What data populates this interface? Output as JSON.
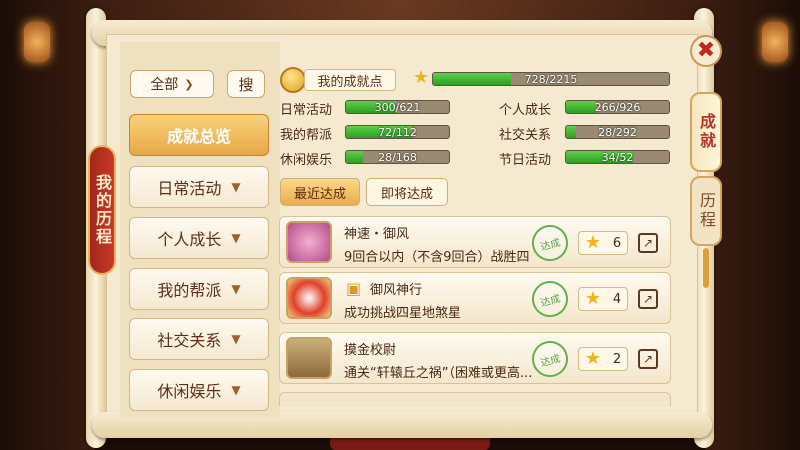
{
  "header": {
    "close_label": "✖"
  },
  "left_banner": "我的历程",
  "right_tabs": [
    {
      "label": "成就"
    },
    {
      "label": "历程"
    }
  ],
  "filter": {
    "selected": "全部",
    "search_label": "搜"
  },
  "categories": [
    {
      "label": "成就总览"
    },
    {
      "label": "日常活动"
    },
    {
      "label": "个人成长"
    },
    {
      "label": "我的帮派"
    },
    {
      "label": "社交关系"
    },
    {
      "label": "休闲娱乐"
    }
  ],
  "points": {
    "label": "我的成就点",
    "value": 728,
    "max": 2215,
    "text": "728/2215"
  },
  "stats": [
    {
      "label": "日常活动",
      "value": 300,
      "max": 621,
      "text": "300/621"
    },
    {
      "label": "个人成长",
      "value": 266,
      "max": 926,
      "text": "266/926"
    },
    {
      "label": "我的帮派",
      "value": 72,
      "max": 112,
      "text": "72/112"
    },
    {
      "label": "社交关系",
      "value": 28,
      "max": 292,
      "text": "28/292"
    },
    {
      "label": "休闲娱乐",
      "value": 28,
      "max": 168,
      "text": "28/168"
    },
    {
      "label": "节日活动",
      "value": 34,
      "max": 52,
      "text": "34/52"
    }
  ],
  "tabs": [
    {
      "label": "最近达成"
    },
    {
      "label": "即将达成"
    }
  ],
  "achievements": [
    {
      "title": "神速・御风",
      "desc": "9回合以内（不含9回合）战胜四",
      "stamp": "达成",
      "points": "6"
    },
    {
      "title": "御风神行",
      "desc": "成功挑战四星地煞星",
      "stamp": "达成",
      "points": "4"
    },
    {
      "title": "摸金校尉",
      "desc": "通关“轩辕丘之祸”（困难或更高...",
      "stamp": "达成",
      "points": "2"
    }
  ],
  "colors": {
    "accent": "#e7a747",
    "bar_fill": "#3fae2f",
    "banner": "#b8342a"
  }
}
